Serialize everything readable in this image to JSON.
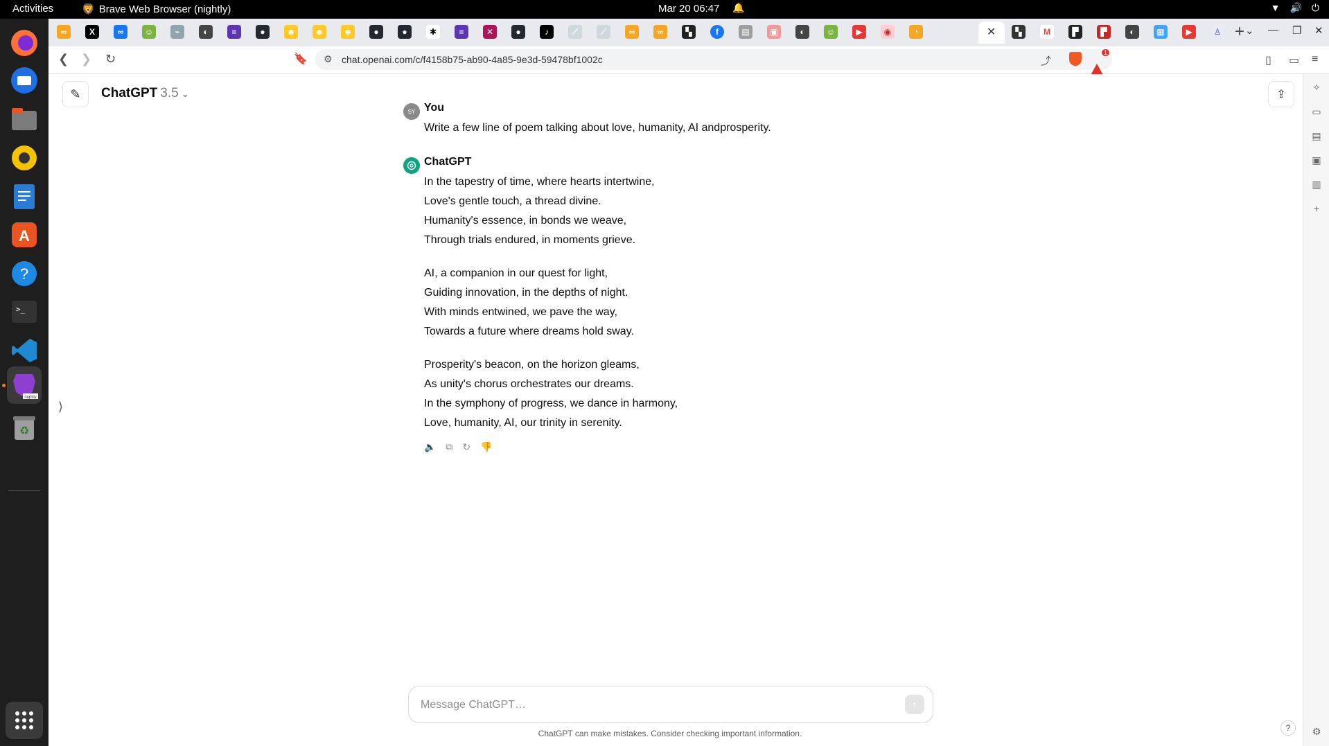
{
  "topbar": {
    "activities": "Activities",
    "app_title": "Brave Web Browser (nightly)",
    "clock": "Mar 20  06:47"
  },
  "dock": {
    "apps": [
      "firefox-icon",
      "thunderbird-icon",
      "files-icon",
      "rhythmbox-icon",
      "writer-icon",
      "app-center-icon",
      "help-icon",
      "terminal-icon",
      "vscode-icon",
      "brave-nightly-icon",
      "trash-icon",
      "show-apps-icon"
    ]
  },
  "browser": {
    "url": "chat.openai.com/c/f4158b75-ab90-4a85-9e3d-59478bf1002c",
    "shields_color": "#f15a22",
    "rewards_badge": "1"
  },
  "page": {
    "model_name": "ChatGPT",
    "model_version": "3.5",
    "messages": [
      {
        "author": "You",
        "avatar": "SY",
        "text": "Write a few line of poem talking about love, humanity, AI andprosperity."
      },
      {
        "author": "ChatGPT",
        "stanzas": [
          [
            "In the tapestry of time, where hearts intertwine,",
            "Love's gentle touch, a thread divine.",
            "Humanity's essence, in bonds we weave,",
            "Through trials endured, in moments grieve."
          ],
          [
            "AI, a companion in our quest for light,",
            "Guiding innovation, in the depths of night.",
            "With minds entwined, we pave the way,",
            "Towards a future where dreams hold sway."
          ],
          [
            "Prosperity's beacon, on the horizon gleams,",
            "As unity's chorus orchestrates our dreams.",
            "In the symphony of progress, we dance in harmony,",
            "Love, humanity, AI, our trinity in serenity."
          ]
        ]
      }
    ],
    "composer_placeholder": "Message ChatGPT…",
    "disclaimer": "ChatGPT can make mistakes. Consider checking important information.",
    "help": "?",
    "accent": "#10a37f"
  }
}
